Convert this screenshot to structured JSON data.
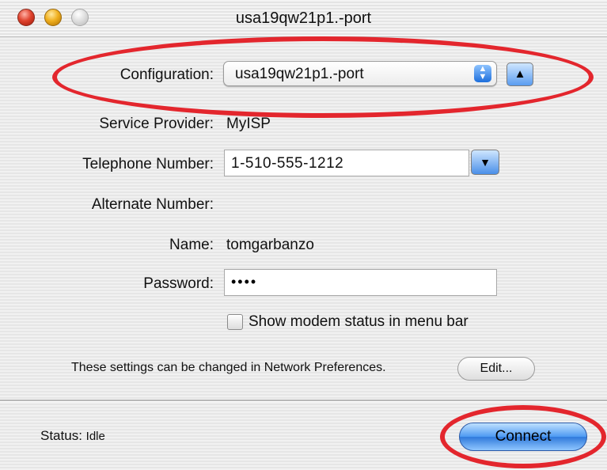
{
  "window": {
    "title": "usa19qw21p1.-port"
  },
  "form": {
    "configuration": {
      "label": "Configuration:",
      "value": "usa19qw21p1.-port"
    },
    "service_provider": {
      "label": "Service Provider:",
      "value": "MyISP"
    },
    "telephone": {
      "label": "Telephone Number:",
      "value": "1-510-555-1212"
    },
    "alternate": {
      "label": "Alternate Number:",
      "value": ""
    },
    "name": {
      "label": "Name:",
      "value": "tomgarbanzo"
    },
    "password": {
      "label": "Password:",
      "value": "••••"
    },
    "show_modem_status": {
      "label": "Show modem status in menu bar",
      "checked": false
    }
  },
  "note": {
    "text": "These settings can be changed in Network Preferences.",
    "edit_label": "Edit..."
  },
  "footer": {
    "status_key": "Status:",
    "status_value": "Idle",
    "connect_label": "Connect"
  },
  "icons": {
    "up_arrow": "▲",
    "down_arrow": "▼",
    "popup_up": "▲",
    "popup_down": "▼"
  },
  "colors": {
    "annotation": "#e3262d",
    "accent_blue": "#2f79db"
  }
}
